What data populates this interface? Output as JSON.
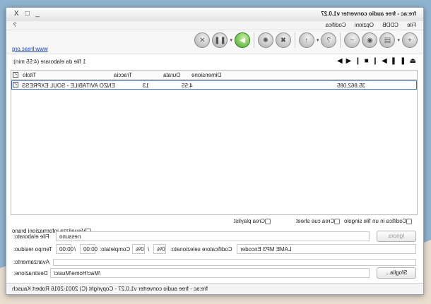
{
  "window": {
    "title": "fre:ac - free audio converter v1.0.27",
    "controls": "_ □ X"
  },
  "menu": {
    "items": [
      "File",
      "CDDB",
      "Opzioni",
      "Codifica"
    ],
    "help": "?"
  },
  "toolbar": {
    "link": "www.freac.org"
  },
  "player": {
    "file_count": "1 file da elaborare (4:55 min):"
  },
  "table": {
    "headers": {
      "title": "Titolo",
      "track": "Traccia",
      "duration": "Durata",
      "size": "Dimensione"
    },
    "rows": [
      {
        "title": "ENZO AVITABILE - SOUL EXPRESS",
        "track": "13",
        "duration": "4:55",
        "size": "35.862.085"
      }
    ]
  },
  "options": {
    "playlist": "Crea playlist",
    "cue": "Crea cue sheet",
    "single_file": "Codifica in un file singolo",
    "show_info": "Visualizza informazioni brano"
  },
  "status": {
    "file_label": "File elaborato:",
    "file_value": "nessuno",
    "ignore_button": "Ignora",
    "time_label": "Tempo residuo:",
    "time_value": "00:00",
    "time_sep": "/",
    "time_total": "00:00",
    "done_label": "Completato:",
    "done_value": "0%",
    "done_sep": "/",
    "done_total": "0%",
    "encoder_label": "Codificatore selezionato:",
    "encoder_value": "LAME MP3 Encoder",
    "progress_label": "Avanzamento:",
    "dest_label": "Destinazione:",
    "dest_value": "/Mac/Home/Music/",
    "browse_button": "Sfoglia..."
  },
  "statusbar": {
    "text": "fre:ac - free audio converter v1.0.27 - Copyright (C) 2001-2016 Robert Kausch"
  }
}
